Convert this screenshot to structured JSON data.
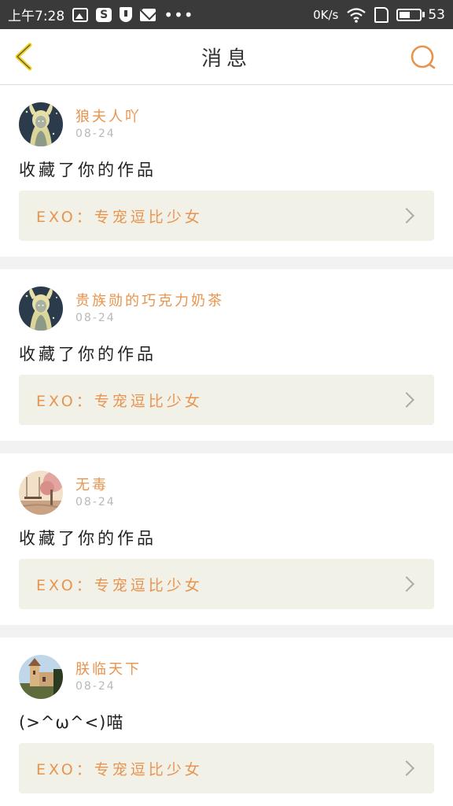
{
  "status_bar": {
    "time": "上午7:28",
    "network_speed": "0K/s",
    "battery": "53",
    "battery_level": 0.53,
    "icons": [
      "image-icon",
      "s-app-icon",
      "shield-icon",
      "mail-icon",
      "more-dots-icon",
      "wifi-icon",
      "sim-icon",
      "battery-icon"
    ],
    "more_dots": "•••"
  },
  "header": {
    "title": "消息",
    "back_icon": "chevron-left-icon",
    "search_icon": "search-icon",
    "accent_color": "#e8944f",
    "back_color": "#f2d31b"
  },
  "messages": [
    {
      "username": "狼夫人吖",
      "date": "08-24",
      "text": "收藏了你的作品",
      "work_title": "EXO：专宠逗比少女",
      "avatar": "anime-girl-avatar"
    },
    {
      "username": "贵族勋的巧克力奶茶",
      "date": "08-24",
      "text": "收藏了你的作品",
      "work_title": "EXO：专宠逗比少女",
      "avatar": "anime-girl-avatar"
    },
    {
      "username": "无毒",
      "date": "08-24",
      "text": "收藏了你的作品",
      "work_title": "EXO：专宠逗比少女",
      "avatar": "swing-scene-avatar"
    },
    {
      "username": "朕临天下",
      "date": "08-24",
      "text": "(>^ω^<)喵",
      "work_title": "EXO：专宠逗比少女",
      "avatar": "castle-avatar"
    }
  ]
}
